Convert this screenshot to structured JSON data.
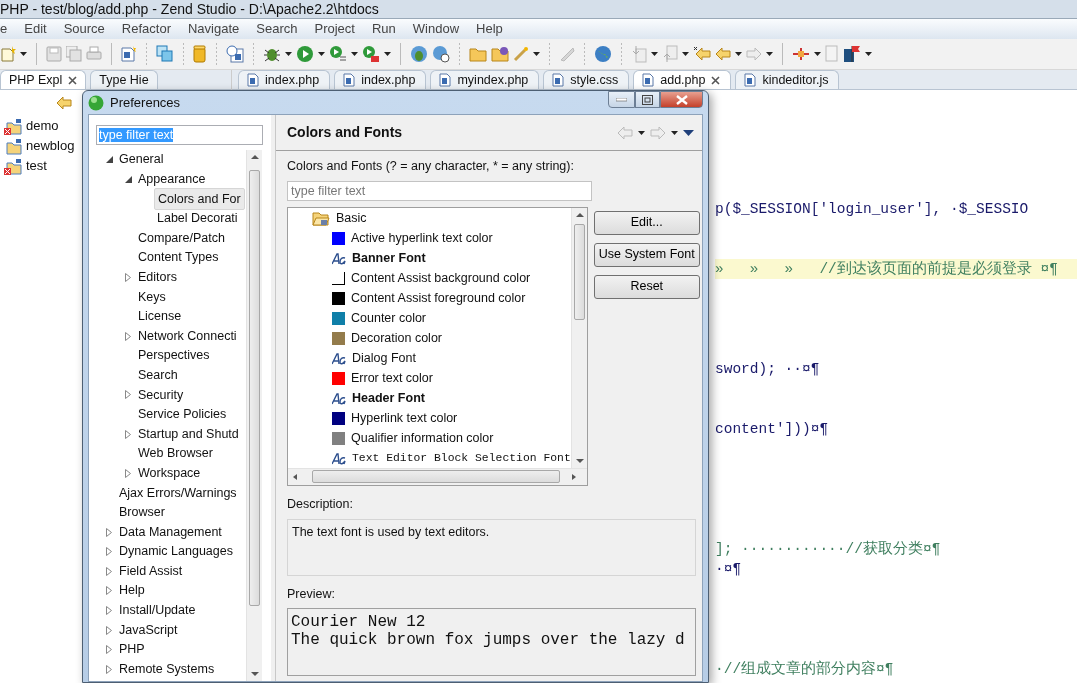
{
  "ide": {
    "title": "PHP - test/blog/add.php - Zend Studio - D:\\Apache2.2\\htdocs",
    "menu": [
      "e",
      "Edit",
      "Source",
      "Refactor",
      "Navigate",
      "Search",
      "Project",
      "Run",
      "Window",
      "Help"
    ],
    "views": [
      {
        "label": "PHP Expl",
        "selected": true,
        "closable": true
      },
      {
        "label": "Type Hie",
        "selected": false,
        "closable": false
      }
    ],
    "projects": [
      {
        "label": "demo",
        "has_error": true
      },
      {
        "label": "newblog",
        "has_error": false
      },
      {
        "label": "test",
        "has_error": true
      }
    ],
    "editor_tabs": [
      {
        "label": "index.php",
        "selected": false,
        "closable": false
      },
      {
        "label": "index.php",
        "selected": false,
        "closable": false
      },
      {
        "label": "myindex.php",
        "selected": false,
        "closable": false
      },
      {
        "label": "style.css",
        "selected": false,
        "closable": false
      },
      {
        "label": "add.php",
        "selected": true,
        "closable": true
      },
      {
        "label": "kindeditor.js",
        "selected": false,
        "closable": false
      }
    ],
    "code_lines": [
      {
        "kind": "code",
        "highlighted": false,
        "text": "p($_SESSION['login_user'], ·$_SESSIO"
      },
      {
        "kind": "comment",
        "highlighted": true,
        "text": "»   »   »   //到达该页面的前提是必须登录 ¤¶"
      },
      {
        "kind": "code",
        "highlighted": false,
        "text": "sword); ··¤¶"
      },
      {
        "kind": "code",
        "highlighted": false,
        "text": "content']))¤¶"
      },
      {
        "kind": "comment",
        "highlighted": false,
        "text": "]; ············//获取分类¤¶"
      },
      {
        "kind": "code",
        "highlighted": false,
        "text": "·¤¶"
      },
      {
        "kind": "comment",
        "highlighted": false,
        "text": "·//组成文章的部分内容¤¶"
      }
    ]
  },
  "dialog": {
    "title": "Preferences",
    "filter": {
      "value": "type filter text",
      "text_selected": true
    },
    "tree": [
      {
        "label": "General",
        "expandable": true,
        "expanded": true,
        "selected": false,
        "children": [
          {
            "label": "Appearance",
            "expandable": true,
            "expanded": true,
            "selected": false,
            "children": [
              {
                "label": "Colors and For",
                "expandable": false,
                "selected": true
              },
              {
                "label": "Label Decorati",
                "expandable": false,
                "selected": false
              }
            ]
          },
          {
            "label": "Compare/Patch",
            "expandable": false,
            "selected": false
          },
          {
            "label": "Content Types",
            "expandable": false,
            "selected": false
          },
          {
            "label": "Editors",
            "expandable": true,
            "expanded": false,
            "selected": false
          },
          {
            "label": "Keys",
            "expandable": false,
            "selected": false
          },
          {
            "label": "License",
            "expandable": false,
            "selected": false
          },
          {
            "label": "Network Connecti",
            "expandable": true,
            "expanded": false,
            "selected": false
          },
          {
            "label": "Perspectives",
            "expandable": false,
            "selected": false
          },
          {
            "label": "Search",
            "expandable": false,
            "selected": false
          },
          {
            "label": "Security",
            "expandable": true,
            "expanded": false,
            "selected": false
          },
          {
            "label": "Service Policies",
            "expandable": false,
            "selected": false
          },
          {
            "label": "Startup and Shutd",
            "expandable": true,
            "expanded": false,
            "selected": false
          },
          {
            "label": "Web Browser",
            "expandable": false,
            "selected": false
          },
          {
            "label": "Workspace",
            "expandable": true,
            "expanded": false,
            "selected": false
          }
        ]
      },
      {
        "label": "Ajax Errors/Warnings",
        "expandable": false,
        "selected": false
      },
      {
        "label": "Browser",
        "expandable": false,
        "selected": false
      },
      {
        "label": "Data Management",
        "expandable": true,
        "expanded": false,
        "selected": false
      },
      {
        "label": "Dynamic Languages",
        "expandable": true,
        "expanded": false,
        "selected": false
      },
      {
        "label": "Field Assist",
        "expandable": true,
        "expanded": false,
        "selected": false
      },
      {
        "label": "Help",
        "expandable": true,
        "expanded": false,
        "selected": false
      },
      {
        "label": "Install/Update",
        "expandable": true,
        "expanded": false,
        "selected": false
      },
      {
        "label": "JavaScript",
        "expandable": true,
        "expanded": false,
        "selected": false
      },
      {
        "label": "PHP",
        "expandable": true,
        "expanded": false,
        "selected": false
      },
      {
        "label": "Remote Systems",
        "expandable": true,
        "expanded": false,
        "selected": false
      }
    ],
    "page": {
      "title": "Colors and Fonts",
      "filter_label": "Colors and Fonts (? = any character, * = any string):",
      "filter": {
        "placeholder": "type filter text"
      },
      "categories": [
        {
          "label": "Basic",
          "expanded": true,
          "children": [
            {
              "kind": "color",
              "label": "Active hyperlink text color",
              "color": "#0000ff"
            },
            {
              "kind": "font",
              "label": "Banner Font",
              "bold": true,
              "monospace": false
            },
            {
              "kind": "color",
              "label": "Content Assist background color",
              "color": "#ffffff"
            },
            {
              "kind": "color",
              "label": "Content Assist foreground color",
              "color": "#000000"
            },
            {
              "kind": "color",
              "label": "Counter color",
              "color": "#0f7fa8"
            },
            {
              "kind": "color",
              "label": "Decoration color",
              "color": "#937b4b"
            },
            {
              "kind": "font",
              "label": "Dialog Font",
              "bold": false,
              "monospace": false
            },
            {
              "kind": "color",
              "label": "Error text color",
              "color": "#ff0000"
            },
            {
              "kind": "font",
              "label": "Header Font",
              "bold": true,
              "monospace": false
            },
            {
              "kind": "color",
              "label": "Hyperlink text color",
              "color": "#000080"
            },
            {
              "kind": "color",
              "label": "Qualifier information color",
              "color": "#808080"
            },
            {
              "kind": "font",
              "label": "Text Editor Block Selection Font",
              "bold": false,
              "monospace": true
            }
          ]
        }
      ],
      "buttons": [
        "Edit...",
        "Use System Font",
        "Reset"
      ],
      "description": {
        "label": "Description:",
        "text": "The text font is used by text editors."
      },
      "preview": {
        "label": "Preview:",
        "lines": [
          "Courier New 12",
          "The quick brown fox jumps over the lazy d"
        ]
      }
    }
  }
}
